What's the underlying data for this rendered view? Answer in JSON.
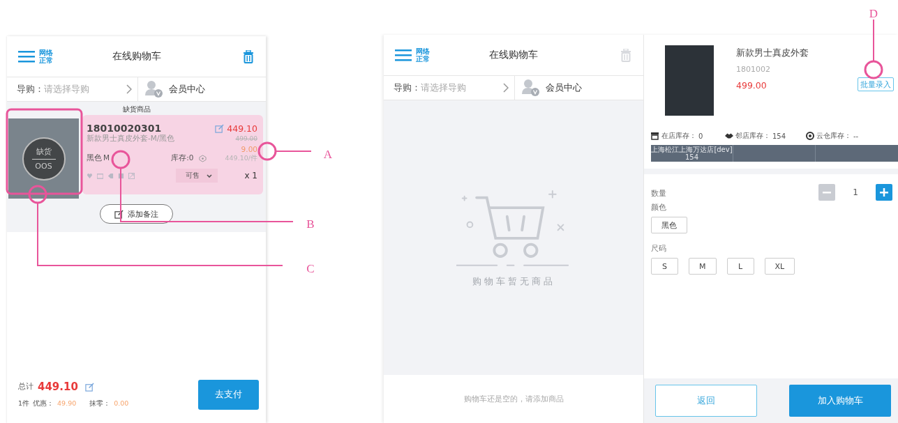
{
  "left_cart": {
    "header": {
      "network_status": [
        "网络",
        "正常"
      ],
      "title": "在线购物车",
      "trash_disabled": false
    },
    "guide": {
      "label": "导购：",
      "placeholder": "请选择导购"
    },
    "member": "会员中心",
    "section_label": "缺货商品",
    "items": [
      {
        "code": "18010020301",
        "name": "新款男士真皮外套-M/黑色",
        "color_name": "黑色",
        "size": "M",
        "stock": "库存:0",
        "price": "449.10",
        "original_price": "499.00",
        "discount": "9.00",
        "unit_price": "449.10/件",
        "quantity": "x 1",
        "status": "可售",
        "out_of_stock": true,
        "badge": [
          "缺货",
          "OOS"
        ]
      }
    ],
    "add_note": "添加备注",
    "footer": {
      "total_label": "总计",
      "total": "449.10",
      "count": "1件",
      "discount_label": "优惠：",
      "discount": "49.90",
      "rounding_label": "抹零：",
      "rounding": "0.00",
      "pay": "去支付"
    }
  },
  "right_cart": {
    "header": {
      "network_status": [
        "网络",
        "正常"
      ],
      "title": "在线购物车",
      "trash_disabled": true
    },
    "guide": {
      "label": "导购：",
      "placeholder": "请选择导购"
    },
    "member": "会员中心",
    "empty_text": "购物车暂无商品",
    "empty_hint": "购物车还是空的，请添加商品"
  },
  "product": {
    "name": "新款男士真皮外套",
    "code": "1801002",
    "price": "499.00",
    "batch_button": "批量录入",
    "stock": [
      {
        "kind": "store",
        "label": "在店库存：",
        "value": "0"
      },
      {
        "kind": "nearby",
        "label": "邻店库存：",
        "value": "154"
      },
      {
        "kind": "cloud",
        "label": "云仓库存：",
        "value": "--"
      }
    ],
    "stores": [
      {
        "name": "上海松江上海万达店[dev]",
        "count": "154"
      }
    ],
    "quantity_label": "数量",
    "quantity": "1",
    "minus_disabled": true,
    "color_label": "颜色",
    "colors": [
      {
        "label": "黑色",
        "selected": false
      }
    ],
    "size_label": "尺码",
    "sizes": [
      {
        "label": "S",
        "selected": false
      },
      {
        "label": "M",
        "selected": false
      },
      {
        "label": "L",
        "selected": false
      },
      {
        "label": "XL",
        "selected": false
      }
    ],
    "back": "返回",
    "add": "加入购物车"
  },
  "annotations": [
    {
      "label": "A"
    },
    {
      "label": "B"
    },
    {
      "label": "C"
    },
    {
      "label": "D"
    }
  ]
}
